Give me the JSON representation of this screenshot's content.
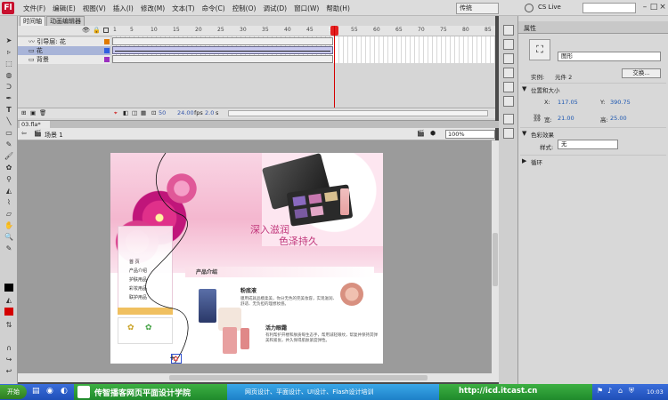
{
  "menubar": {
    "logo": "Fl",
    "items": [
      "文件(F)",
      "编辑(E)",
      "视图(V)",
      "插入(I)",
      "修改(M)",
      "文本(T)",
      "命令(C)",
      "控制(O)",
      "调试(D)",
      "窗口(W)",
      "帮助(H)"
    ],
    "workspace": "传统",
    "cslive": "CS Live"
  },
  "timeline": {
    "tabs": [
      "时间轴",
      "动画编辑器"
    ],
    "layers": [
      "引导层: 花",
      "花",
      "背景"
    ],
    "frame_numbers": [
      "1",
      "5",
      "10",
      "15",
      "20",
      "25",
      "30",
      "35",
      "40",
      "45",
      "50",
      "55",
      "60",
      "65",
      "70",
      "75",
      "80",
      "85"
    ],
    "current_frame": "50",
    "fps": "24.00",
    "fps_unit": "fps",
    "time": "2.0",
    "time_unit": "s"
  },
  "scene": {
    "tab": "03.fla*",
    "name": "场景 1",
    "zoom": "100%"
  },
  "stage": {
    "headline1": "深入滋润",
    "headline2": "色泽持久",
    "nav_items": [
      "首 页",
      "产品介绍",
      "护肤用品",
      "彩妆用品",
      "联护用品"
    ],
    "section_title": "产品介绍",
    "product1_name": "粉底液",
    "product1_desc": "膜用成就品模柔美，你分无色的完美妆容，实现滋润、舒适、无负担的理想妆感。",
    "product2_name": "活力眼霜",
    "product2_desc": "有利帮护开楼和肤质每生态手，帮用减轻眼纹，帮复并保持其弹美和紧张，并久保得肌肤紧度弹性。"
  },
  "properties": {
    "tab": "属性",
    "symbol_type": "图形",
    "instance_label": "实例:",
    "instance_name": "元件 2",
    "swap_button": "交换...",
    "section_position": "位置和大小",
    "x_label": "X:",
    "x_value": "117.05",
    "y_label": "Y:",
    "y_value": "390.75",
    "w_label": "宽:",
    "w_value": "21.00",
    "h_label": "高:",
    "h_value": "25.00",
    "section_color": "色彩效果",
    "style_label": "样式:",
    "style_value": "无",
    "section_loop": "循环"
  },
  "taskbar": {
    "start": "开始",
    "brand": "传智播客网页平面设计学院",
    "courses": "网页设计、平面设计、UI设计、Flash设计培训",
    "url": "http://icd.itcast.cn",
    "clock": "10:03"
  },
  "colors": {
    "accent_red": "#d40000",
    "banner_green": "#2b9a35",
    "banner_blue": "#1d8fd6",
    "stage_pink": "#f4b7cf"
  }
}
